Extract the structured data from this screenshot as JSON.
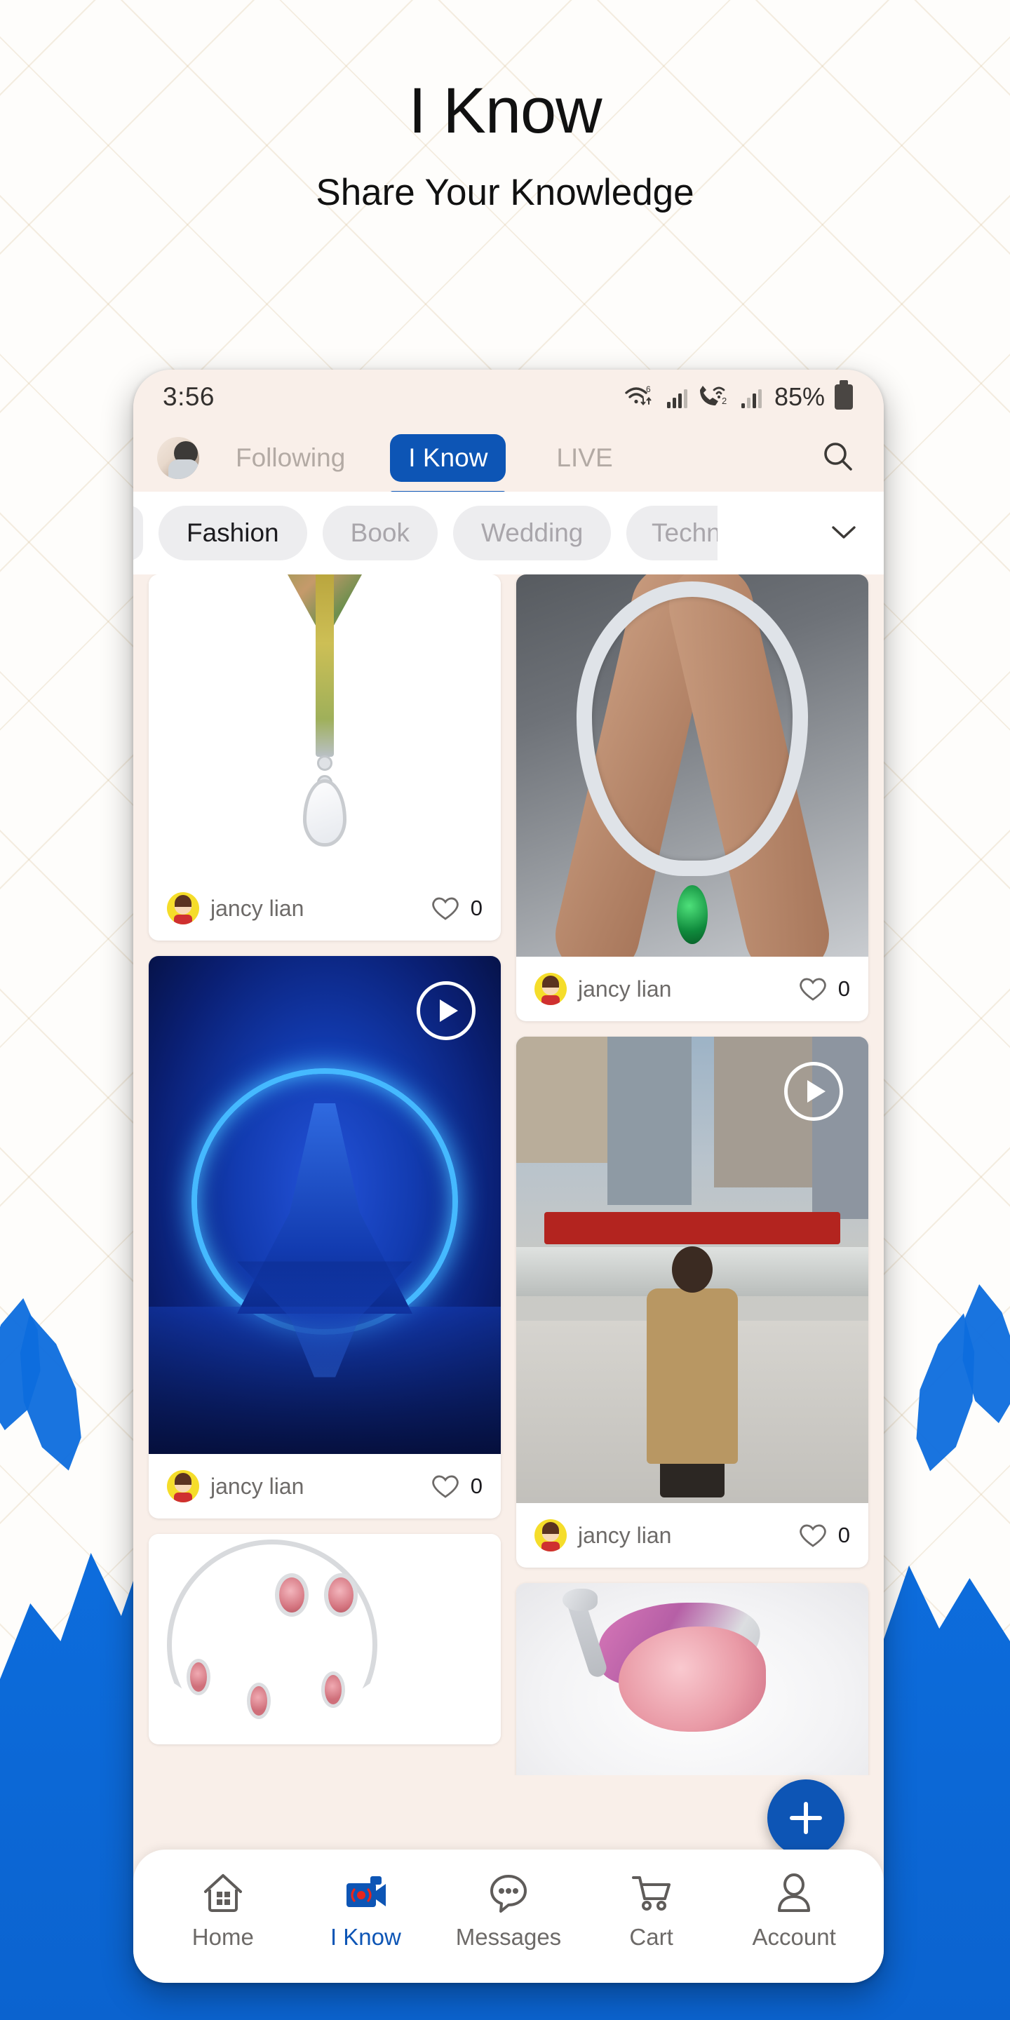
{
  "promo": {
    "title": "I Know",
    "subtitle": "Share Your Knowledge"
  },
  "colors": {
    "brand_blue": "#0d55b5",
    "splash_blue": "#0d6ddd",
    "status_text": "#33302e",
    "muted_text": "#b3aaa4",
    "card_bg": "#ffffff",
    "feed_bg": "#f9efe9"
  },
  "status_bar": {
    "time": "3:56",
    "wifi_generation": "6",
    "volte_badge": "2",
    "battery_percent": "85%",
    "icons": [
      "wifi-6-icon",
      "signal-bars-icon",
      "vowifi-call-icon",
      "signal-bars-icon",
      "battery-icon"
    ]
  },
  "top_nav": {
    "avatar": "user-avatar",
    "search_icon": "search-icon",
    "tabs": [
      {
        "label": "Following",
        "active": false
      },
      {
        "label": "I Know",
        "active": true
      },
      {
        "label": "LIVE",
        "active": false
      }
    ]
  },
  "category_chips": {
    "chevron_icon": "chevron-down-icon",
    "items": [
      {
        "label": "",
        "active": false,
        "partial": true
      },
      {
        "label": "Fashion",
        "active": true
      },
      {
        "label": "Book",
        "active": false
      },
      {
        "label": "Wedding",
        "active": false
      },
      {
        "label": "Techn",
        "active": false,
        "clipped": true
      }
    ]
  },
  "feed": {
    "left_column": [
      {
        "media": "necklace-green-pendant",
        "is_video": false,
        "author": "jancy lian",
        "likes": "0",
        "like_icon": "heart-outline-icon"
      },
      {
        "media": "blue-neon-gown-video",
        "is_video": true,
        "play_icon": "play-circle-icon",
        "author": "jancy lian",
        "likes": "0",
        "like_icon": "heart-outline-icon"
      },
      {
        "media": "diamond-necklace-earring-set",
        "is_video": false,
        "author": "",
        "likes": "",
        "like_icon": "heart-outline-icon"
      }
    ],
    "right_column": [
      {
        "media": "diamond-necklace-emerald-arms",
        "is_video": false,
        "author": "jancy lian",
        "likes": "0",
        "like_icon": "heart-outline-icon"
      },
      {
        "media": "street-fashion-child-video",
        "is_video": true,
        "play_icon": "play-circle-icon",
        "author": "jancy lian",
        "likes": "0",
        "like_icon": "heart-outline-icon"
      },
      {
        "media": "pink-swan-brooch",
        "is_video": false,
        "author": "",
        "likes": "",
        "like_icon": "heart-outline-icon"
      }
    ]
  },
  "fab": {
    "icon": "plus-icon",
    "label": "Add"
  },
  "bottom_nav": [
    {
      "label": "Home",
      "icon": "home-icon",
      "active": false
    },
    {
      "label": "I Know",
      "icon": "video-camera-icon",
      "active": true
    },
    {
      "label": "Messages",
      "icon": "chat-bubble-icon",
      "active": false
    },
    {
      "label": "Cart",
      "icon": "shopping-cart-icon",
      "active": false
    },
    {
      "label": "Account",
      "icon": "person-icon",
      "active": false
    }
  ]
}
